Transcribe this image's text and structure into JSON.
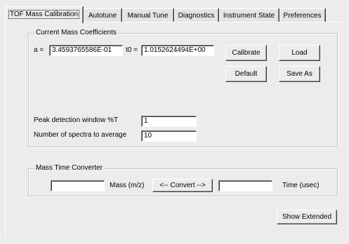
{
  "tabs": [
    {
      "label": "TOF Mass Calibration",
      "active": true
    },
    {
      "label": "Autotune",
      "active": false
    },
    {
      "label": "Manual Tune",
      "active": false
    },
    {
      "label": "Diagnostics",
      "active": false
    },
    {
      "label": "Instrument State",
      "active": false
    },
    {
      "label": "Preferences",
      "active": false
    }
  ],
  "coefficients": {
    "group_title": "Current Mass Coefficients",
    "a_label": "a =",
    "a_value": "3.4593765586E-01",
    "t0_label": "t0 =",
    "t0_value": "1.0152624494E+00",
    "calibrate_label": "Calibrate",
    "load_label": "Load",
    "default_label": "Default",
    "save_as_label": "Save As",
    "peak_window_label": "Peak detection window %T",
    "peak_window_value": "1",
    "num_spectra_label": "Number of spectra to average",
    "num_spectra_value": "10"
  },
  "converter": {
    "group_title": "Mass Time Converter",
    "mass_value": "",
    "mass_label": "Mass (m/z)",
    "convert_label": "<-- Convert -->",
    "time_value": "",
    "time_label": "Time (usec)"
  },
  "show_extended_label": "Show Extended"
}
